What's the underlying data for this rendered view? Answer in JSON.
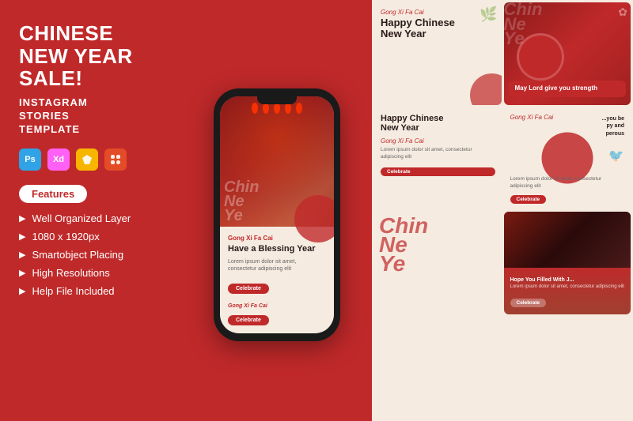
{
  "left": {
    "title_line1": "CHINESE NEW YEAR",
    "title_line2": "SALE!",
    "subtitle_line1": "INSTAGRAM",
    "subtitle_line2": "STORIES",
    "subtitle_line3": "TEMPLATE",
    "apps": [
      {
        "name": "Ps",
        "key": "ps"
      },
      {
        "name": "Xd",
        "key": "xd"
      },
      {
        "name": "Sk",
        "key": "sketch"
      },
      {
        "name": "Fig",
        "key": "fig"
      }
    ],
    "features_label": "Features",
    "features": [
      "Well Organized Layer",
      "1080 x 1920px",
      "Smartobject Placing",
      "High Resolutions",
      "Help File Included"
    ]
  },
  "phone": {
    "gong": "Gong Xi Fa Cai",
    "title": "Have a Blessing Year",
    "text": "Lorem ipsum dolor sit amet, consectetur adipiscing elit",
    "btn": "Celebrate",
    "bottom_gong": "Gong Xi Fa Cai",
    "btn2": "Celebrate"
  },
  "cards": [
    {
      "id": "card1",
      "gong": "Gong Xi Fa Cai",
      "title": "Happy Chinese\nNew Year",
      "type": "text-card"
    },
    {
      "id": "card2",
      "overlay_text": "Chinese\nNew\nYear",
      "blessing": "May Lord give\nyou strength",
      "type": "image-card-red"
    },
    {
      "id": "card3",
      "title": "Happy Chinese\nNew Year",
      "subtitle": "Gong Xi Fa Cai",
      "text": "Lorem ipsum dolor sit amet, consectetur adipiscing elit",
      "btn": "Celebrate",
      "type": "text-image-card"
    },
    {
      "id": "card4",
      "gong": "Gong Xi Fa Cai",
      "text": "Lorem ipsum dolor sit amet, consectetur adipiscing elit",
      "btn": "Celebrate",
      "extra": "...you be\npy and\nperous",
      "type": "mixed-card"
    },
    {
      "id": "card5",
      "overlay_text": "Chine\nNew\nYea",
      "type": "calligraphy-card"
    },
    {
      "id": "card6",
      "title": "Hope You Filled With J...",
      "text": "Lorem ipsum dolor sit amet, consectetur adipiscing elit",
      "btn": "Celebrate",
      "type": "dark-image-card"
    }
  ]
}
